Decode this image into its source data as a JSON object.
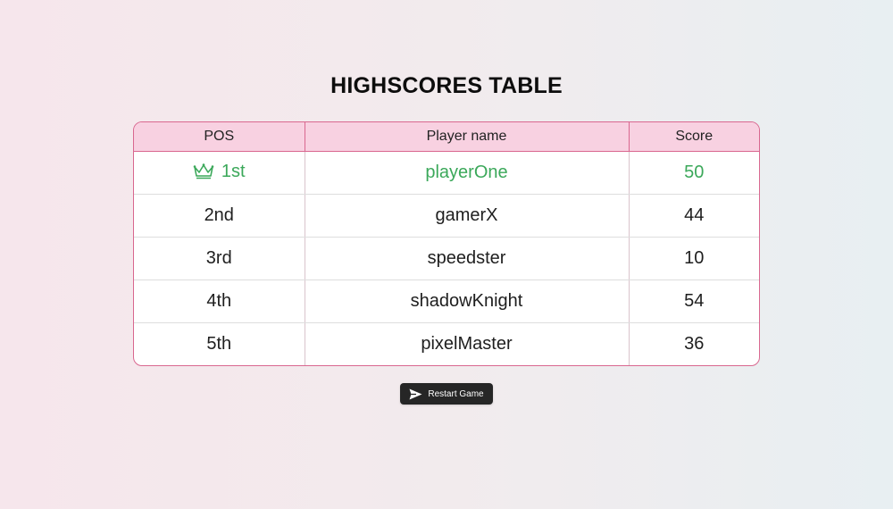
{
  "title": "HIGHSCORES TABLE",
  "table": {
    "headers": [
      "POS",
      "Player name",
      "Score"
    ],
    "rows": [
      {
        "pos": "1st",
        "name": "playerOne",
        "score": "50",
        "icon": "crown-icon"
      },
      {
        "pos": "2nd",
        "name": "gamerX",
        "score": "44"
      },
      {
        "pos": "3rd",
        "name": "speedster",
        "score": "10"
      },
      {
        "pos": "4th",
        "name": "shadowKnight",
        "score": "54"
      },
      {
        "pos": "5th",
        "name": "pixelMaster",
        "score": "36"
      }
    ]
  },
  "restart_button": {
    "label": "Restart Game",
    "icon": "send-icon"
  },
  "colors": {
    "header_bg": "#f8d1e1",
    "border": "#d9678f",
    "top_row_text": "#3ba85a",
    "button_bg": "#262626"
  }
}
